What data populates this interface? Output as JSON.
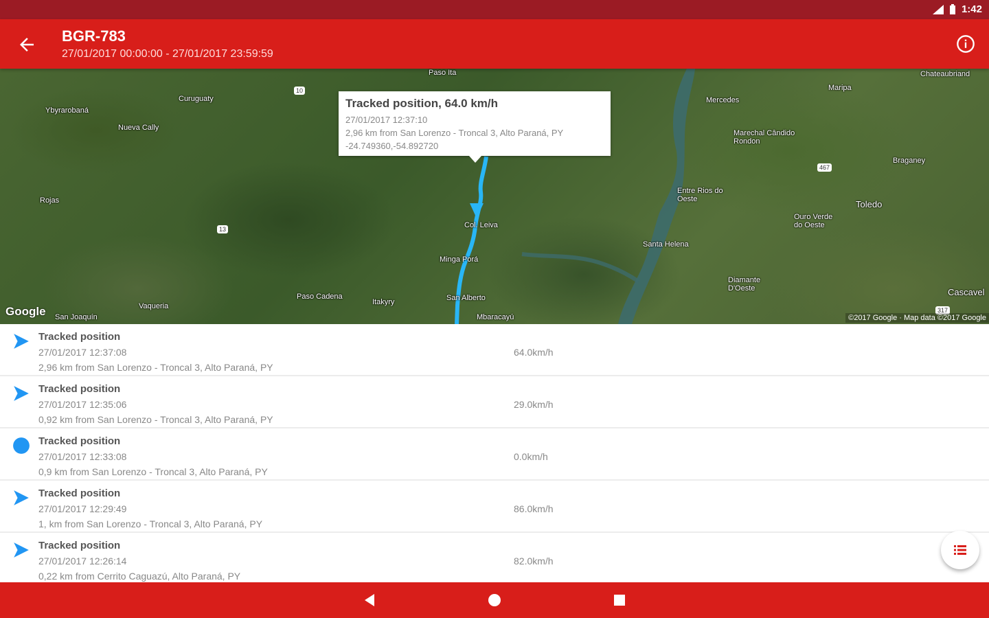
{
  "status_bar": {
    "time": "1:42"
  },
  "app_bar": {
    "title": "BGR-783",
    "subtitle": "27/01/2017 00:00:00 - 27/01/2017 23:59:59"
  },
  "map": {
    "info_window": {
      "title": "Tracked position, 64.0 km/h",
      "time": "27/01/2017 12:37:10",
      "address": "2,96 km from San Lorenzo - Troncal 3, Alto Paraná, PY",
      "coords": "-24.749360,-54.892720"
    },
    "labels": [
      "Paso Ita",
      "Curuguaty",
      "Ybyrarobaná",
      "Nueva Cally",
      "Rojas",
      "Col. Leiva",
      "Minga Porá",
      "Paso Cadena",
      "Itakyry",
      "San Alberto",
      "Mbaracayú",
      "Vaqueria",
      "San Joaquín",
      "Mercedes",
      "Maripa",
      "Marechal Cândido Rondon",
      "Entre Rios do Oeste",
      "Ouro Verde do Oeste",
      "Toledo",
      "Santa Helena",
      "Diamante D'Oeste",
      "Cascavel",
      "Chateaubriand",
      "Braganey"
    ],
    "road_badges": [
      "10",
      "13",
      "467",
      "317"
    ],
    "attribution": "Google",
    "copyright": "©2017 Google · Map data ©2017 Google"
  },
  "positions": [
    {
      "title": "Tracked position",
      "time": "27/01/2017 12:37:08",
      "address": "2,96 km from San Lorenzo - Troncal 3, Alto Paraná, PY",
      "speed": "64.0km/h",
      "icon": "navigation-arrow-icon"
    },
    {
      "title": "Tracked position",
      "time": "27/01/2017 12:35:06",
      "address": "0,92 km from San Lorenzo - Troncal 3, Alto Paraná, PY",
      "speed": "29.0km/h",
      "icon": "navigation-arrow-icon"
    },
    {
      "title": "Tracked position",
      "time": "27/01/2017 12:33:08",
      "address": "0,9 km from San Lorenzo - Troncal 3, Alto Paraná, PY",
      "speed": "0.0km/h",
      "icon": "stopped-dot-icon"
    },
    {
      "title": "Tracked position",
      "time": "27/01/2017 12:29:49",
      "address": "1, km from San Lorenzo - Troncal 3, Alto Paraná, PY",
      "speed": "86.0km/h",
      "icon": "navigation-arrow-icon"
    },
    {
      "title": "Tracked position",
      "time": "27/01/2017 12:26:14",
      "address": "0,22 km from Cerrito Caguazú, Alto Paraná, PY",
      "speed": "82.0km/h",
      "icon": "navigation-arrow-icon"
    }
  ],
  "colors": {
    "status_bar": "#9b1b24",
    "app_bar": "#d81e1a",
    "route": "#29b6f6",
    "marker": "#2196f3"
  }
}
